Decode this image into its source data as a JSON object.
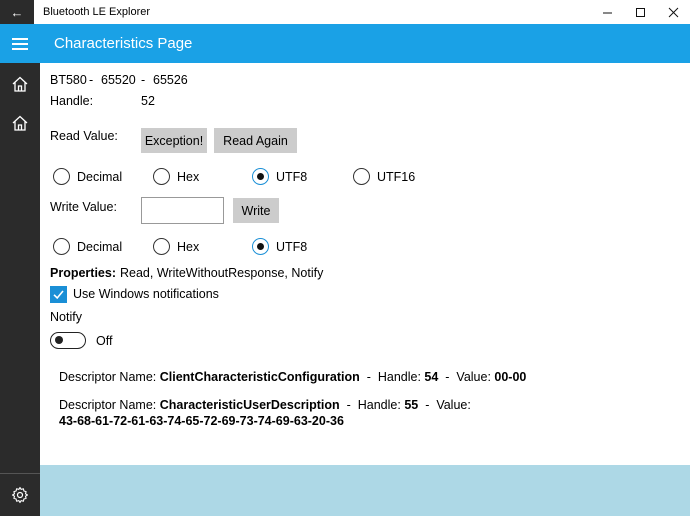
{
  "window": {
    "title": "Bluetooth LE Explorer",
    "back_glyph": "←",
    "min_glyph": "—",
    "max_glyph": "☐",
    "close_glyph": "✕"
  },
  "appbar": {
    "title": "Characteristics Page",
    "accent": "#1aa1e6"
  },
  "characteristic": {
    "name": "BT580",
    "sep": "-",
    "service_id": "65520",
    "char_id": "65526",
    "handle_label": "Handle:",
    "handle_value": "52"
  },
  "read": {
    "label": "Read Value:",
    "value_button": "Exception!",
    "read_again_button": "Read Again",
    "formats": [
      "Decimal",
      "Hex",
      "UTF8",
      "UTF16"
    ],
    "selected": "UTF8"
  },
  "write": {
    "label": "Write Value:",
    "input_value": "",
    "write_button": "Write",
    "formats": [
      "Decimal",
      "Hex",
      "UTF8"
    ],
    "selected": "UTF8"
  },
  "properties": {
    "label": "Properties:",
    "value": "Read, WriteWithoutResponse, Notify"
  },
  "notifications": {
    "checkbox_label": "Use Windows notifications",
    "checked": true
  },
  "notify": {
    "label": "Notify",
    "toggle_state": "Off"
  },
  "descriptors": [
    {
      "name_label": "Descriptor Name:",
      "name": "ClientCharacteristicConfiguration",
      "sep": "-",
      "handle_label": "Handle:",
      "handle": "54",
      "value_label": "Value:",
      "value": "00-00"
    },
    {
      "name_label": "Descriptor Name:",
      "name": "CharacteristicUserDescription",
      "sep": "-",
      "handle_label": "Handle:",
      "handle": "55",
      "value_label": "Value:",
      "value": "43-68-61-72-61-63-74-65-72-69-73-74-69-63-20-36"
    }
  ],
  "sidebar": {
    "items": [
      {
        "icon": "home-icon"
      },
      {
        "icon": "home-icon"
      }
    ],
    "settings_icon": "gear-icon"
  }
}
